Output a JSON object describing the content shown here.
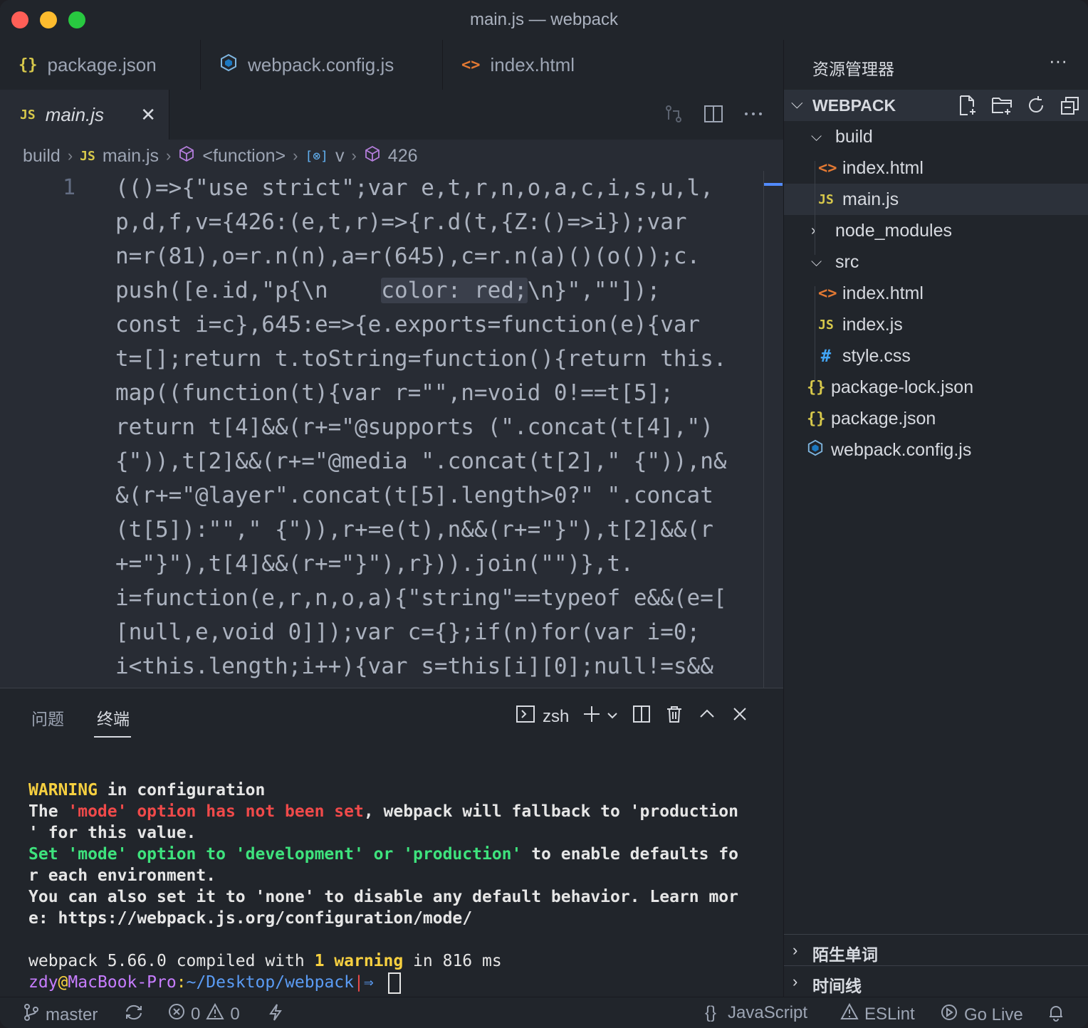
{
  "window": {
    "title": "main.js — webpack"
  },
  "top_tabs": [
    {
      "label": "package.json",
      "icon": "json-icon"
    },
    {
      "label": "webpack.config.js",
      "icon": "webpack-icon"
    },
    {
      "label": "index.html",
      "icon": "html-icon"
    }
  ],
  "editor_tab": {
    "label": "main.js",
    "icon_text": "JS",
    "close": "✕"
  },
  "json_icon_text": "{}",
  "html_icon_text": "<>",
  "js_icon_text": "JS",
  "css_icon_text": "#",
  "breadcrumb": [
    "build",
    "main.js",
    "<function>",
    "v",
    "426"
  ],
  "code": {
    "line_number": "1",
    "lines": [
      "(()=>{\"use strict\";var e,t,r,n,o,a,c,i,s,u,l,",
      "p,d,f,v={426:(e,t,r)=>{r.d(t,{Z:()=>i});var",
      "n=r(81),o=r.n(n),a=r(645),c=r.n(a)()(o());c.",
      "push([e.id,\"p{\\n    color: red;\\n}\",\"\"]);",
      "const i=c},645:e=>{e.exports=function(e){var",
      "t=[];return t.toString=function(){return this.",
      "map((function(t){var r=\"\",n=void 0!==t[5];",
      "return t[4]&&(r+=\"@supports (\".concat(t[4],\")",
      "{\")),t[2]&&(r+=\"@media \".concat(t[2],\" {\")),n&",
      "&(r+=\"@layer\".concat(t[5].length>0?\" \".concat",
      "(t[5]):\"\",\" {\")),r+=e(t),n&&(r+=\"}\"),t[2]&&(r",
      "+=\"}\"),t[4]&&(r+=\"}\"),r})).join(\"\")},t.",
      "i=function(e,r,n,o,a){\"string\"==typeof e&&(e=[",
      "[null,e,void 0]]);var c={};if(n)for(var i=0;",
      "i<this.length;i++){var s=this[i][0];null!=s&&"
    ],
    "line4_parts": [
      "push([e.id,\"p{\\n    ",
      "color: red;",
      "\\n}\",\"\"]);"
    ]
  },
  "panel": {
    "tabs": [
      "问题",
      "终端"
    ],
    "shell": "zsh",
    "terminal": {
      "warn_word": "WARNING",
      "warn_rest": " in configuration",
      "l2a": "The ",
      "l2b": "'mode' option has not been set",
      "l2c": ", webpack will fallback to 'production",
      "l3": "' for this value.",
      "l4a": "Set 'mode' option to 'development' or 'production'",
      "l4b": " to enable defaults fo",
      "l5": "r each environment.",
      "l6": "You can also set it to 'none' to disable any default behavior. Learn mor",
      "l7": "e: https://webpack.js.org/configuration/mode/",
      "l9a": "webpack 5.66.0 compiled with ",
      "l9b": "1 warning",
      "l9c": " in 816 ms",
      "prompt_user": "zdy",
      "prompt_at": "@",
      "prompt_host": "MacBook-Pro",
      "prompt_colon": ":",
      "prompt_path": "~/Desktop/webpack",
      "prompt_bar": "|",
      "prompt_arrow": "⇒"
    }
  },
  "sidebar": {
    "title": "资源管理器",
    "more": "···",
    "section": "WEBPACK",
    "tree": [
      {
        "label": "build",
        "kind": "folder-open"
      },
      {
        "label": "index.html",
        "kind": "html"
      },
      {
        "label": "main.js",
        "kind": "js"
      },
      {
        "label": "node_modules",
        "kind": "folder-closed"
      },
      {
        "label": "src",
        "kind": "folder-open"
      },
      {
        "label": "index.html",
        "kind": "html"
      },
      {
        "label": "index.js",
        "kind": "js"
      },
      {
        "label": "style.css",
        "kind": "css"
      },
      {
        "label": "package-lock.json",
        "kind": "json"
      },
      {
        "label": "package.json",
        "kind": "json"
      },
      {
        "label": "webpack.config.js",
        "kind": "webpack"
      }
    ],
    "bottom_sections": [
      "陌生单词",
      "时间线"
    ]
  },
  "status": {
    "branch": "master",
    "errors": "0",
    "warnings": "0",
    "language_icon_text": "{}",
    "language": "JavaScript",
    "eslint": "ESLint",
    "golive": "Go Live"
  },
  "colors": {
    "accent": "#528bff",
    "editor_bg": "#282c34",
    "sidebar_bg": "#21252b"
  }
}
